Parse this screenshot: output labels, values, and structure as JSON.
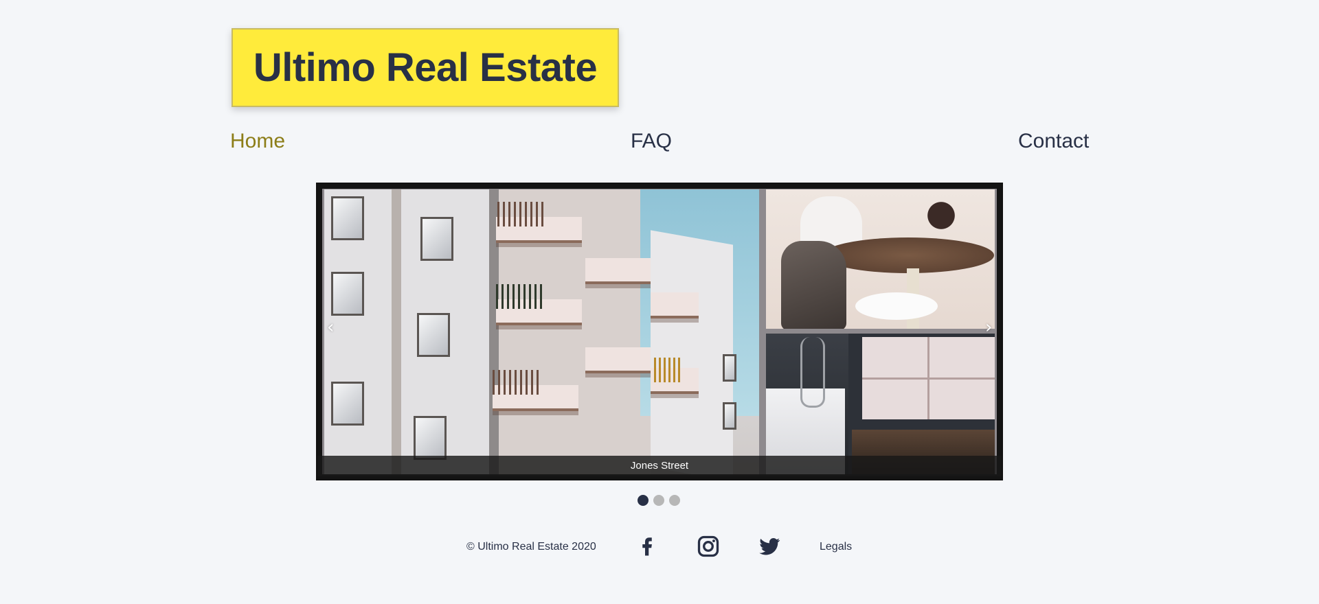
{
  "logo": {
    "text": "Ultimo Real Estate"
  },
  "nav": [
    {
      "label": "Home",
      "active": true
    },
    {
      "label": "FAQ",
      "active": false
    },
    {
      "label": "Contact",
      "active": false
    }
  ],
  "carousel": {
    "prev_icon": "‹",
    "next_icon": "›",
    "caption": "Jones Street",
    "slides_total": 3,
    "current_slide": 1
  },
  "footer": {
    "copyright": "© Ultimo Real Estate 2020",
    "social": [
      {
        "icon": "facebook-icon"
      },
      {
        "icon": "instagram-icon"
      },
      {
        "icon": "twitter-icon"
      }
    ],
    "legals": "Legals"
  },
  "colors": {
    "background": "#f4f6f9",
    "logo_bg": "#ffeb3b",
    "text": "#283046",
    "active_nav": "#8c7d18"
  }
}
